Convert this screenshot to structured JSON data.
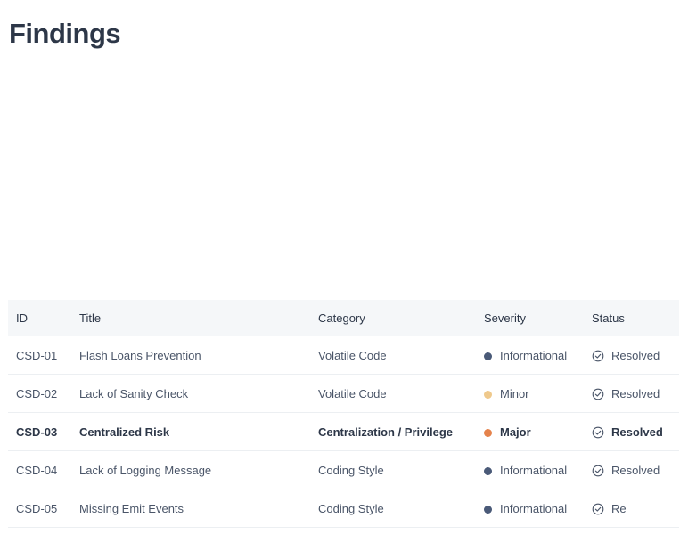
{
  "page": {
    "title": "Findings"
  },
  "table": {
    "columns": [
      "ID",
      "Title",
      "Category",
      "Severity",
      "Status"
    ],
    "rows": [
      {
        "id": "CSD-01",
        "title": "Flash Loans Prevention",
        "category": "Volatile Code",
        "severity": "Informational",
        "status": "Resolved",
        "bold": false
      },
      {
        "id": "CSD-02",
        "title": "Lack of Sanity Check",
        "category": "Volatile Code",
        "severity": "Minor",
        "status": "Resolved",
        "bold": false
      },
      {
        "id": "CSD-03",
        "title": "Centralized Risk",
        "category": "Centralization / Privilege",
        "severity": "Major",
        "status": "Resolved",
        "bold": true
      },
      {
        "id": "CSD-04",
        "title": "Lack of Logging Message",
        "category": "Coding Style",
        "severity": "Informational",
        "status": "Resolved",
        "bold": false
      },
      {
        "id": "CSD-05",
        "title": "Missing Emit Events",
        "category": "Coding Style",
        "severity": "Informational",
        "status": "Re",
        "bold": false
      }
    ]
  },
  "severity_colors": {
    "Informational": "#4a5a78",
    "Minor": "#efc98c",
    "Major": "#e5834c"
  },
  "icons": {
    "status": "check-circle-icon"
  }
}
